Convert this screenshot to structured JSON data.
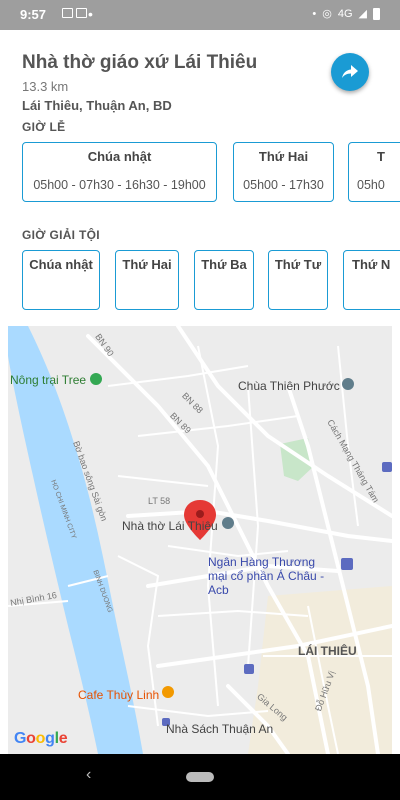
{
  "status": {
    "time": "9:57",
    "network": "4G"
  },
  "header": {
    "title": "Nhà thờ giáo xứ Lái Thiêu",
    "distance": "13.3 km",
    "address": "Lái Thiêu, Thuận An, BD"
  },
  "mass": {
    "label": "GIỜ LỄ",
    "cards": [
      {
        "day": "Chúa nhật",
        "hours": "05h00 - 07h30 - 16h30 - 19h00"
      },
      {
        "day": "Thứ Hai",
        "hours": "05h00 - 17h30"
      },
      {
        "day": "T",
        "hours": "05h0"
      }
    ]
  },
  "confession": {
    "label": "GIỜ GIẢI TỘI",
    "cards": [
      {
        "day": "Chúa nhật"
      },
      {
        "day": "Thứ Hai"
      },
      {
        "day": "Thứ Ba"
      },
      {
        "day": "Thứ Tư"
      },
      {
        "day": "Thứ N"
      }
    ]
  },
  "map": {
    "places": {
      "farm": "Nông trại Tree",
      "pagoda": "Chùa Thiên Phước",
      "church": "Nhà thờ Lái Thiêu",
      "bank": "Ngân Hàng Thương mại cổ phần Á Châu - Acb",
      "district": "LÁI THIÊU",
      "cafe": "Cafe Thùy Linh",
      "bookstore": "Nhà Sách Thuận An"
    },
    "roads": {
      "bn90": "BN 90",
      "bn88": "BN 88",
      "bn89": "BN 89",
      "lt58": "LT 58",
      "bo_bao": "Bờ bao sông Sài gòn",
      "hcm_city": "HO CHI MINH CITY",
      "binh_duong": "BINH DUONG",
      "nhi_binh": "Nhị Bình 16",
      "cach_mang": "Cách Mạng Tháng Tám",
      "gia_long": "Gia Long",
      "bo_huu_vi": "Đỗ Hữu Vị"
    },
    "attribution": {
      "g1": "G",
      "o1": "o",
      "o2": "o",
      "g2": "g",
      "l": "l",
      "e": "e"
    },
    "colors": {
      "river": "#aadaff",
      "land": "#e8e8e8",
      "park": "#c8e6c9",
      "pin": "#e53935"
    }
  }
}
